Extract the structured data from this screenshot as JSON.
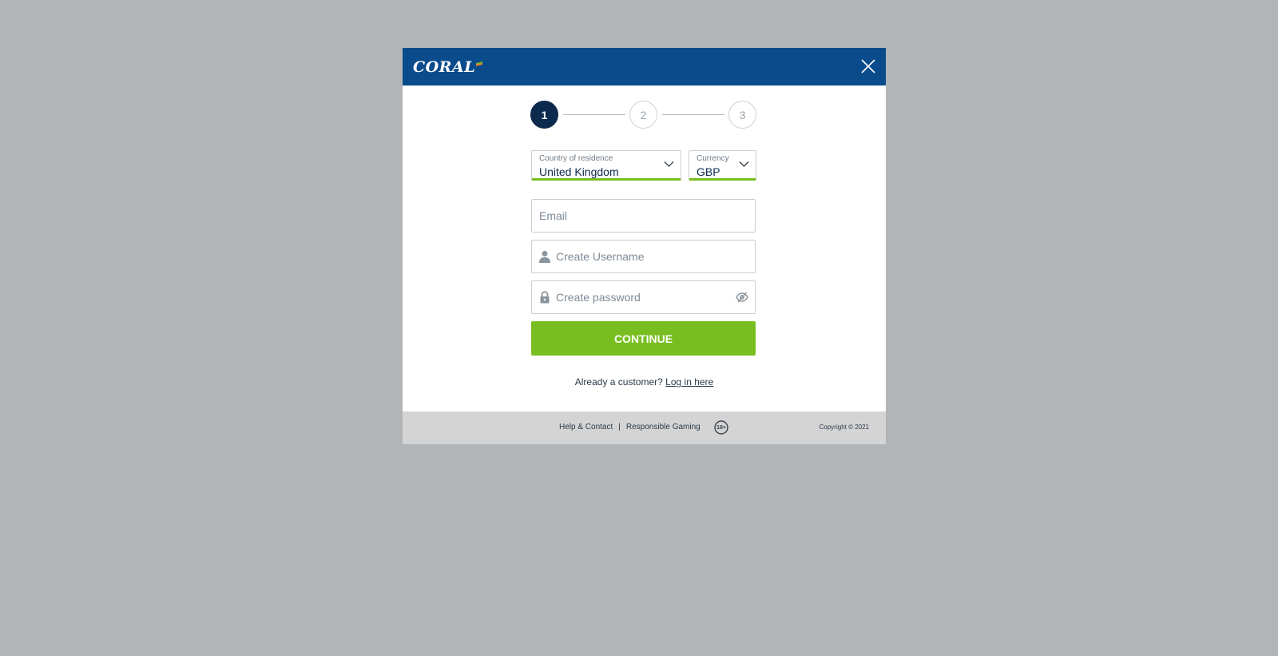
{
  "brand": {
    "logo_text": "CORAL",
    "header_color": "#0a4b8c",
    "accent_green": "#78be20",
    "dark_navy": "#0c2a4d"
  },
  "header": {
    "close_icon": "close-icon"
  },
  "stepper": {
    "steps": [
      "1",
      "2",
      "3"
    ],
    "active_step": 1
  },
  "form": {
    "country": {
      "label": "Country of residence",
      "value": "United Kingdom"
    },
    "currency": {
      "label": "Currency",
      "value": "GBP"
    },
    "email": {
      "placeholder": "Email",
      "value": ""
    },
    "username": {
      "placeholder": "Create Username",
      "value": "",
      "icon": "user-icon"
    },
    "password": {
      "placeholder": "Create password",
      "value": "",
      "icon": "lock-icon",
      "toggle_icon": "eye-hidden-icon"
    },
    "continue_label": "CONTINUE"
  },
  "login": {
    "prompt": "Already a customer?",
    "link_label": "Log in here"
  },
  "footer": {
    "help_label": "Help & Contact",
    "separator": "|",
    "responsible_label": "Responsible Gaming",
    "age_badge": "18+",
    "copyright": "Copyright © 2021"
  }
}
